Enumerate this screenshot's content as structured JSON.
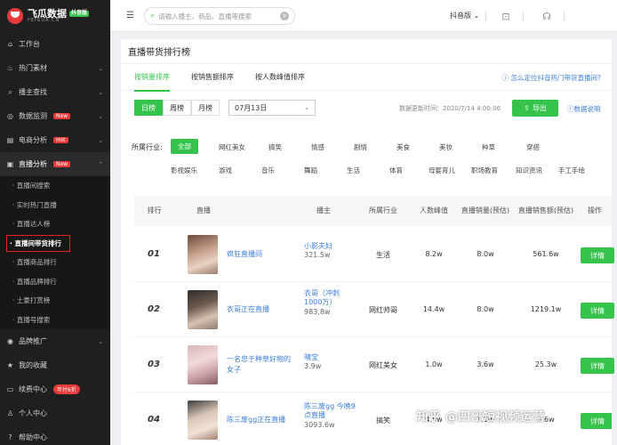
{
  "logo": {
    "name": "飞瓜数据",
    "tag": "抖音版",
    "sub": "FEIGUA.CN"
  },
  "sidebar": {
    "items": [
      {
        "label": "工作台",
        "icon": "home-icon"
      },
      {
        "label": "热门素材",
        "icon": "fire-icon"
      },
      {
        "label": "播主查找",
        "icon": "search-icon"
      },
      {
        "label": "数据监测",
        "icon": "monitor-icon",
        "badge": "New"
      },
      {
        "label": "电商分析",
        "icon": "chart-icon",
        "badge": "Hot"
      },
      {
        "label": "直播分析",
        "icon": "live-icon",
        "badge": "New"
      }
    ],
    "live_sub": [
      "直播间搜索",
      "实时热门直播",
      "直播达人榜",
      "直播间带货排行",
      "直播商品排行",
      "直播品牌排行",
      "土豪打赏榜",
      "直播号搜索"
    ],
    "bottom": [
      {
        "label": "品牌推广",
        "icon": "brand-icon"
      },
      {
        "label": "我的收藏",
        "icon": "star-icon"
      },
      {
        "label": "续费中心",
        "icon": "wallet-icon",
        "badge": "年付6折"
      },
      {
        "label": "个人中心",
        "icon": "user-icon"
      },
      {
        "label": "帮助中心",
        "icon": "help-icon"
      }
    ]
  },
  "topbar": {
    "search_placeholder": "请输入播主、商品、直播等搜索",
    "platform": "抖音版"
  },
  "panel": {
    "title": "直播带货排行榜",
    "tabs": [
      "按销量排序",
      "按销售额排序",
      "按人数峰值排序"
    ],
    "help": "怎么定位抖音热门带货直播间?",
    "periods": [
      "日榜",
      "周榜",
      "月榜"
    ],
    "date": "07月13日",
    "update_time": "数据更新时间：2020/7/14 4:00:06",
    "export": "导出",
    "explain": "数据说明",
    "industry_label": "所属行业:",
    "industries": [
      "全部",
      "网红美女",
      "搞笑",
      "情感",
      "剧情",
      "美食",
      "美妆",
      "种草",
      "穿搭",
      "影视娱乐",
      "游戏",
      "音乐",
      "舞蹈",
      "生活",
      "体育",
      "母婴育儿",
      "职场教育",
      "知识资讯",
      "手工手绘"
    ]
  },
  "table": {
    "headers": [
      "排行",
      "直播",
      "播主",
      "所属行业",
      "人数峰值",
      "直播销量(预估)",
      "直播销售额(预估)",
      "操作"
    ],
    "rows": [
      {
        "rank": "01",
        "title": "疯狂直播间",
        "host": "小影夫妇",
        "fans": "321.5w",
        "industry": "生活",
        "peak": "8.2w",
        "sales": "8.0w",
        "revenue": "561.6w",
        "action": "详情"
      },
      {
        "rank": "02",
        "title": "衣哥正在直播",
        "host": "衣哥（冲刺1000万）",
        "fans": "983.8w",
        "industry": "网红帅哥",
        "peak": "14.4w",
        "sales": "8.0w",
        "revenue": "1219.1w",
        "action": "详情"
      },
      {
        "rank": "03",
        "title": "一名忠于种草好物的女子",
        "host": "晴宝",
        "fans": "3.9w",
        "industry": "网红美女",
        "peak": "1.0w",
        "sales": "3.6w",
        "revenue": "25.3w",
        "action": "详情"
      },
      {
        "rank": "04",
        "title": "陈三废gg正在直播",
        "host": "陈三废gg 今晚9点直播",
        "fans": "3093.6w",
        "industry": "搞笑",
        "peak": "4.5w",
        "sales": "3.5w",
        "revenue": "3.6w",
        "action": "详情"
      }
    ]
  },
  "watermark": "知乎 @四哥短视频运营"
}
